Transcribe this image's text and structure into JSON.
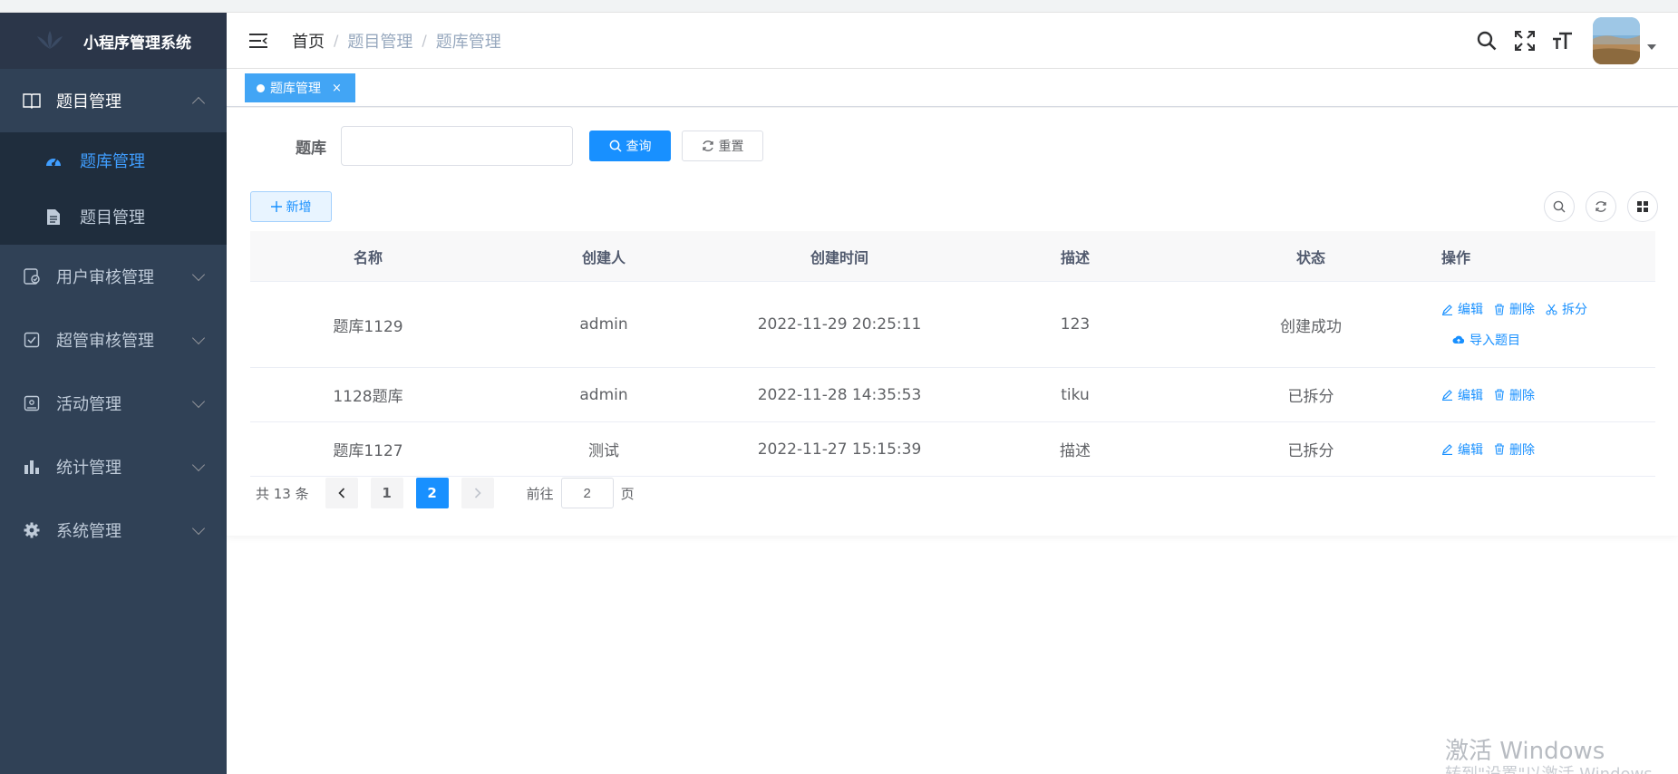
{
  "app": {
    "title": "小程序管理系统"
  },
  "sidebar": {
    "groups": [
      {
        "label": "题目管理",
        "icon": "book-icon",
        "open": true,
        "children": [
          {
            "label": "题库管理",
            "icon": "dashboard-icon",
            "active": true
          },
          {
            "label": "题目管理",
            "icon": "document-icon",
            "active": false
          }
        ]
      },
      {
        "label": "用户审核管理",
        "icon": "audit-icon"
      },
      {
        "label": "超管审核管理",
        "icon": "checkbox-icon"
      },
      {
        "label": "活动管理",
        "icon": "image-icon"
      },
      {
        "label": "统计管理",
        "icon": "bar-chart-icon"
      },
      {
        "label": "系统管理",
        "icon": "gear-icon"
      }
    ]
  },
  "breadcrumb": {
    "home": "首页",
    "level1": "题目管理",
    "level2": "题库管理"
  },
  "tags": {
    "active_tag": "题库管理",
    "close": "×"
  },
  "search": {
    "label": "题库",
    "value": "",
    "query_label": "查询",
    "reset_label": "重置"
  },
  "toolbar": {
    "add_label": "新增"
  },
  "table": {
    "columns": [
      "名称",
      "创建人",
      "创建时间",
      "描述",
      "状态",
      "操作"
    ],
    "rows": [
      {
        "name": "题库1129",
        "creator": "admin",
        "created": "2022-11-29 20:25:11",
        "desc": "123",
        "status": "创建成功",
        "ops": [
          "编辑",
          "删除",
          "拆分",
          "导入题目"
        ]
      },
      {
        "name": "1128题库",
        "creator": "admin",
        "created": "2022-11-28 14:35:53",
        "desc": "tiku",
        "status": "已拆分",
        "ops": [
          "编辑",
          "删除"
        ]
      },
      {
        "name": "题库1127",
        "creator": "测试",
        "created": "2022-11-27 15:15:39",
        "desc": "描述",
        "status": "已拆分",
        "ops": [
          "编辑",
          "删除"
        ]
      }
    ]
  },
  "pagination": {
    "total": "共 13 条",
    "pages": [
      "1",
      "2"
    ],
    "current": "2",
    "goto_label": "前往",
    "goto_value": "2",
    "page_suffix": "页"
  },
  "watermark": {
    "line1": "激活 Windows",
    "line2": "转到\"设置\"以激活 Windows。"
  },
  "colors": {
    "sidebar_bg": "#304156",
    "accent": "#1890ff",
    "active_menu": "#409eff"
  }
}
